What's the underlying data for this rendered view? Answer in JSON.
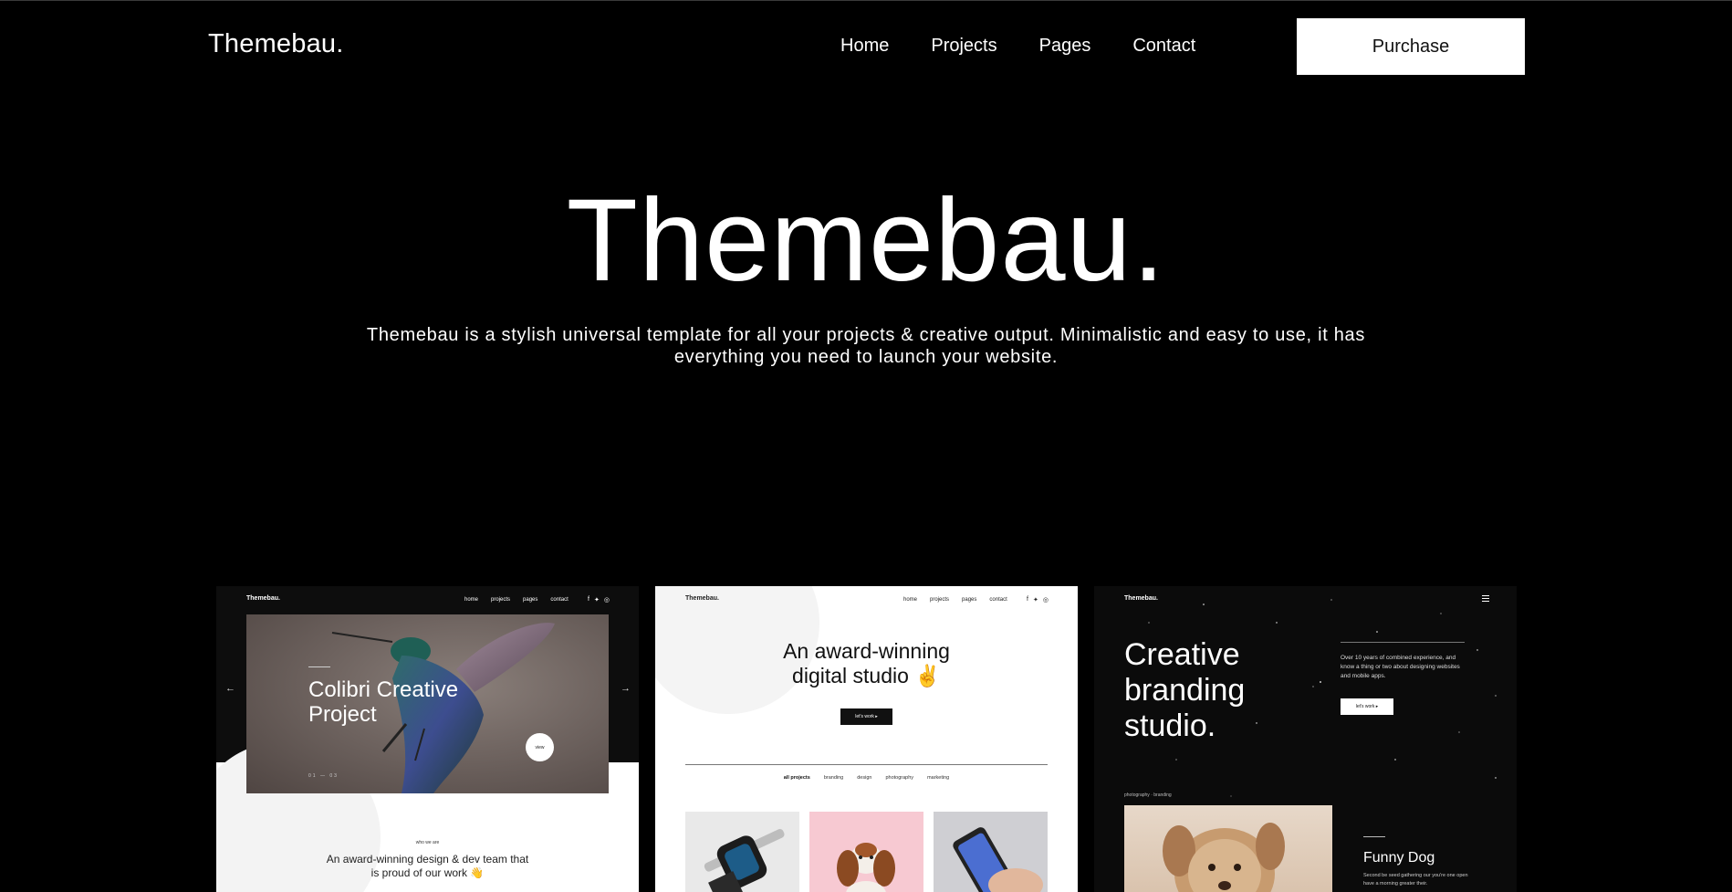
{
  "header": {
    "logo": "Themebau.",
    "nav": [
      "Home",
      "Projects",
      "Pages",
      "Contact"
    ],
    "purchase_label": "Purchase"
  },
  "hero": {
    "title": "Themebau.",
    "description": "Themebau is a stylish universal template for all your projects & creative output. Minimalistic and easy to use, it has everything you need to launch your website."
  },
  "previews": {
    "mini_logo": "Themebau.",
    "mini_nav": [
      "home",
      "projects",
      "pages",
      "contact"
    ],
    "card1": {
      "project_title": "Colibri Creative Project",
      "view_label": "view",
      "pager": "01 — 03",
      "arrow_left": "←",
      "arrow_right": "→",
      "who_label": "who we are",
      "team_text": "An award-winning design & dev team that is proud of our work 👋"
    },
    "card2": {
      "headline": "An award-winning digital studio ✌",
      "cta": "let's work  ▸",
      "filters": [
        "all projects",
        "branding",
        "design",
        "photography",
        "marketing"
      ]
    },
    "card3": {
      "headline": "Creative branding studio.",
      "experience": "Over 10 years of combined experience, and know a thing or two about designing websites and mobile apps.",
      "cta": "let's work  ▸",
      "tag": "photography · branding",
      "project_title": "Funny Dog",
      "project_desc": "Second be seed gathering our you're one open have a morning greater their."
    }
  },
  "colors": {
    "background": "#000000",
    "text": "#ffffff",
    "button_bg": "#ffffff"
  },
  "icons": [
    "facebook-icon",
    "twitter-icon",
    "instagram-icon",
    "menu-icon",
    "arrow-left-icon",
    "arrow-right-icon"
  ]
}
